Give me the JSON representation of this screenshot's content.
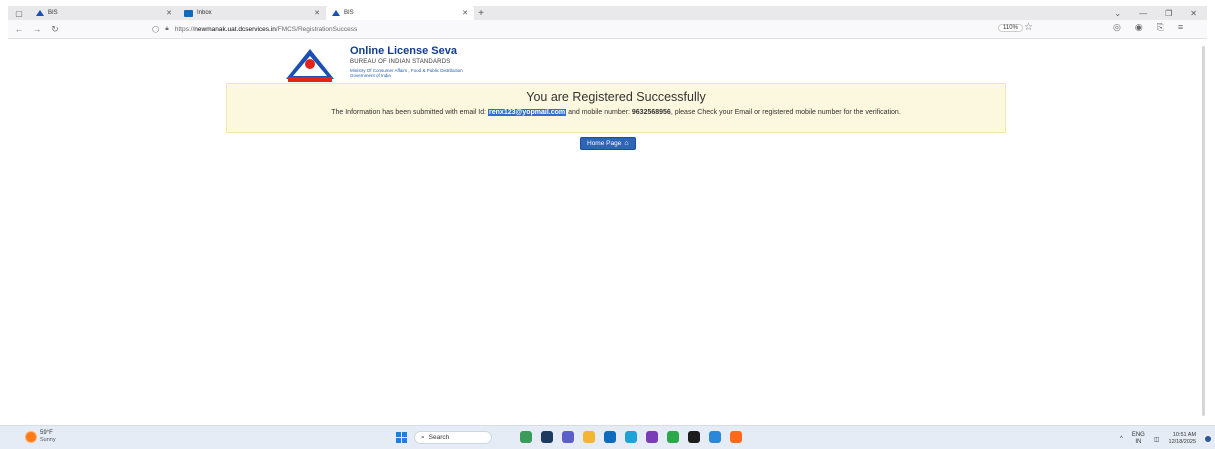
{
  "browser": {
    "tabs": [
      {
        "title": "BIS",
        "favicon": "bis-icon"
      },
      {
        "title": "Inbox",
        "favicon": "mail-icon"
      },
      {
        "title": "BIS",
        "favicon": "bis-icon",
        "active": true
      }
    ],
    "url_prefix": "https://",
    "url_domain": "newmanak.uat.dcservices.in",
    "url_path": "/FMCS/RegistrationSuccess",
    "zoom": "110%"
  },
  "header": {
    "title": "Online License Seva",
    "org": "BUREAU OF INDIAN STANDARDS",
    "ministry": "Ministry Of Consumer Affairs , Food & Public Distribution",
    "govt": "Government of India"
  },
  "alert": {
    "heading": "You are Registered Successfully",
    "msg_part1": "The Information has been submitted with email Id: ",
    "email": "renx123@yopmail.com",
    "msg_part2": " and mobile number: ",
    "mobile": "9632568956",
    "msg_part3": ", please Check your Email or registered mobile number for the verification."
  },
  "home_button": {
    "label": "Home Page"
  },
  "taskbar": {
    "temp": "59°F",
    "weather": "Sunny",
    "search_placeholder": "Search",
    "lang_top": "ENG",
    "lang_bottom": "IN",
    "time": "10:51 AM",
    "date": "12/18/2025"
  },
  "colors": {
    "accent": "#2f66b3",
    "alert_bg": "#fcf7df",
    "brand": "#123c8c"
  }
}
